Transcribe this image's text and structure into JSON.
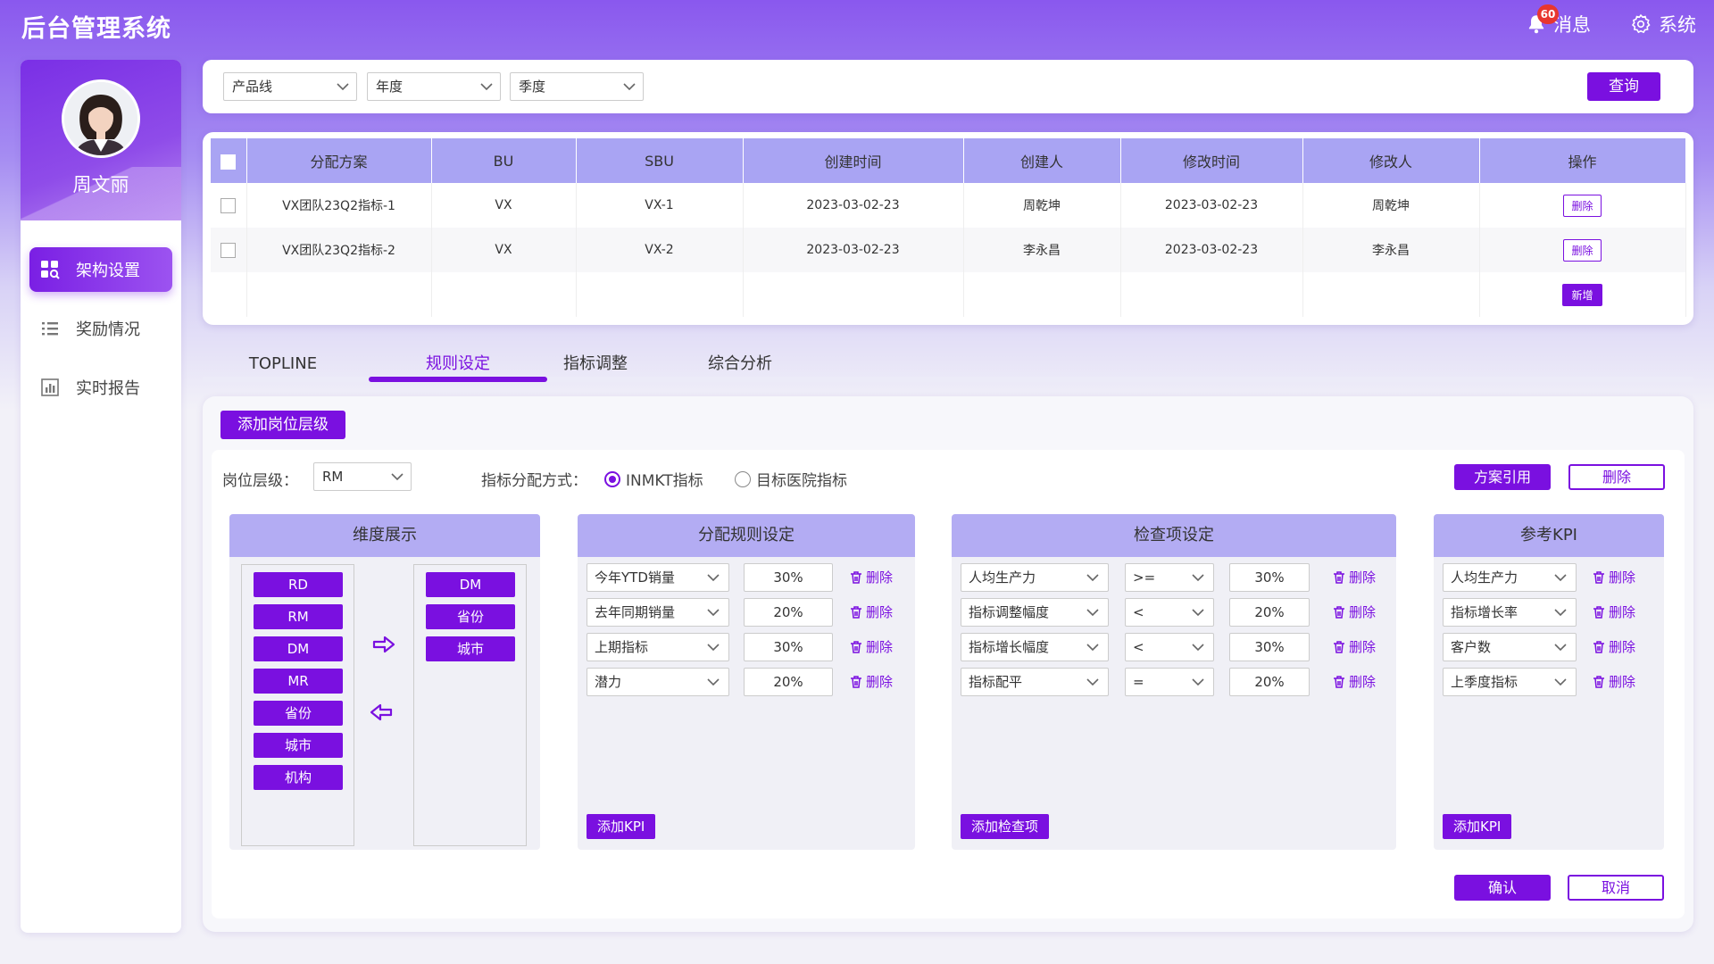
{
  "app": {
    "title": "后台管理系统"
  },
  "header": {
    "badge_count": "60",
    "messages_label": "消息",
    "system_label": "系统"
  },
  "user": {
    "name": "周文丽"
  },
  "sidebar": {
    "items": [
      {
        "label": "架构设置",
        "icon": "grid-search-icon",
        "active": true
      },
      {
        "label": "奖励情况",
        "icon": "list-icon",
        "active": false
      },
      {
        "label": "实时报告",
        "icon": "bar-chart-icon",
        "active": false
      }
    ]
  },
  "filters": {
    "product_line": {
      "placeholder": "产品线"
    },
    "year": {
      "placeholder": "年度"
    },
    "quarter": {
      "placeholder": "季度"
    },
    "query_label": "查询"
  },
  "table": {
    "columns": [
      "分配方案",
      "BU",
      "SBU",
      "创建时间",
      "创建人",
      "修改时间",
      "修改人",
      "操作"
    ],
    "rows": [
      {
        "plan": "VX团队23Q2指标-1",
        "bu": "VX",
        "sbu": "VX-1",
        "created": "2023-03-02-23",
        "creator": "周乾坤",
        "modified": "2023-03-02-23",
        "modifier": "周乾坤",
        "action": "删除"
      },
      {
        "plan": "VX团队23Q2指标-2",
        "bu": "VX",
        "sbu": "VX-2",
        "created": "2023-03-02-23",
        "creator": "李永昌",
        "modified": "2023-03-02-23",
        "modifier": "李永昌",
        "action": "删除"
      }
    ],
    "add_label": "新增"
  },
  "tabs": [
    {
      "label": "TOPLINE",
      "active": false
    },
    {
      "label": "规则设定",
      "active": true
    },
    {
      "label": "指标调整",
      "active": false
    },
    {
      "label": "综合分析",
      "active": false
    }
  ],
  "rules": {
    "add_level_label": "添加岗位层级",
    "level_label": "岗位层级：",
    "level_value": "RM",
    "method_label": "指标分配方式：",
    "method_options": [
      "INMKT指标",
      "目标医院指标"
    ],
    "method_selected": "INMKT指标",
    "apply_label": "方案引用",
    "delete_label": "删除",
    "confirm_label": "确认",
    "cancel_label": "取消"
  },
  "dimension": {
    "title": "维度展示",
    "available": [
      "RD",
      "RM",
      "DM",
      "MR",
      "省份",
      "城市",
      "机构"
    ],
    "selected": [
      "DM",
      "省份",
      "城市"
    ]
  },
  "allocation": {
    "title": "分配规则设定",
    "rows": [
      {
        "metric": "今年YTD销量",
        "value": "30%"
      },
      {
        "metric": "去年同期销量",
        "value": "20%"
      },
      {
        "metric": "上期指标",
        "value": "30%"
      },
      {
        "metric": "潜力",
        "value": "20%"
      }
    ],
    "delete_label": "删除",
    "add_label": "添加KPI"
  },
  "check": {
    "title": "检查项设定",
    "rows": [
      {
        "metric": "人均生产力",
        "op": ">=",
        "value": "30%"
      },
      {
        "metric": "指标调整幅度",
        "op": "<",
        "value": "20%"
      },
      {
        "metric": "指标增长幅度",
        "op": "<",
        "value": "30%"
      },
      {
        "metric": "指标配平",
        "op": "=",
        "value": "20%"
      }
    ],
    "delete_label": "删除",
    "add_label": "添加检查项"
  },
  "kpi": {
    "title": "参考KPI",
    "rows": [
      {
        "metric": "人均生产力"
      },
      {
        "metric": "指标增长率"
      },
      {
        "metric": "客户数"
      },
      {
        "metric": "上季度指标"
      }
    ],
    "delete_label": "删除",
    "add_label": "添加KPI"
  },
  "colors": {
    "accent": "#7a10e0",
    "header_bg": "#8a58ee",
    "panel_head": "#b3acf3",
    "badge": "#e8362f"
  }
}
